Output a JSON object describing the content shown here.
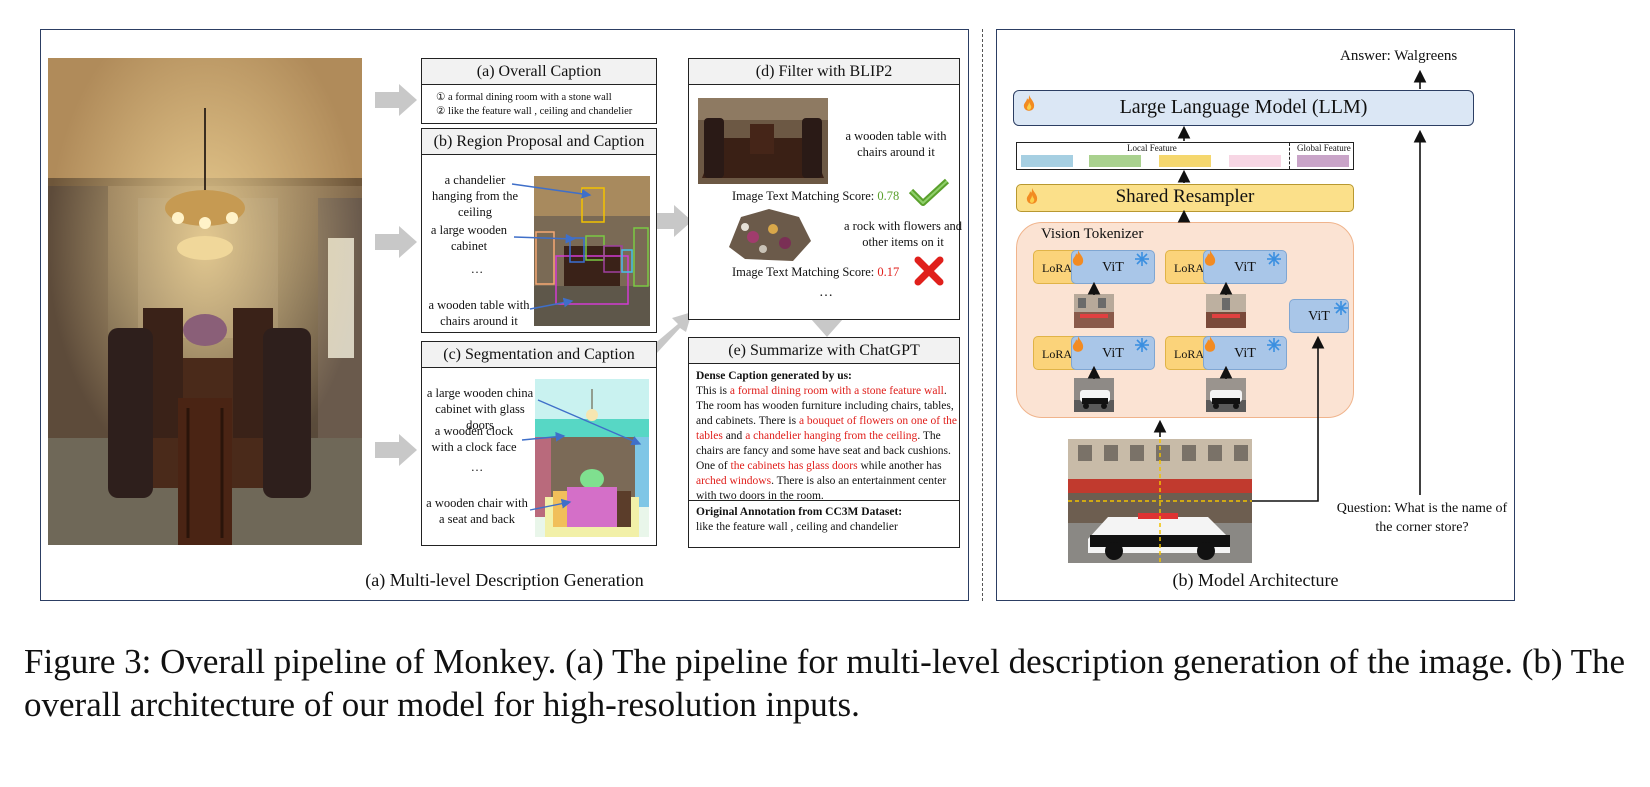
{
  "left_panel": {
    "title": "(a) Multi-level Description Generation",
    "overall": {
      "title": "(a) Overall Caption",
      "line1": "① a formal dining room with a stone wall",
      "line2": "② like the feature wall , ceiling and chandelier"
    },
    "region": {
      "title": "(b) Region Proposal and Caption",
      "captions": [
        "a chandelier hanging from the ceiling",
        "a large wooden cabinet",
        "…",
        "a wooden table with chairs around it"
      ]
    },
    "segmentation": {
      "title": "(c) Segmentation and Caption",
      "captions": [
        "a large wooden china cabinet with glass doors",
        "a wooden clock with a clock face",
        "…",
        "a wooden chair with a seat and back"
      ]
    },
    "filter": {
      "title": "(d) Filter with BLIP2",
      "item1_caption": "a wooden table with chairs around it",
      "item1_score_label": "Image Text Matching Score:",
      "item1_score": "0.78",
      "item2_caption": "a rock with flowers and other items on it",
      "item2_score_label": "Image Text Matching Score:",
      "item2_score": "0.17",
      "ellipsis": "…"
    },
    "summarize": {
      "title": "(e) Summarize with ChatGPT",
      "dense_heading": "Dense Caption generated by us:",
      "segments": [
        {
          "text": "This is ",
          "hl": false
        },
        {
          "text": "a formal dining room with a stone feature wall",
          "hl": true
        },
        {
          "text": ". The room has wooden furniture including chairs, tables, and cabinets. There is ",
          "hl": false
        },
        {
          "text": "a bouquet of flowers on one of the tables",
          "hl": true
        },
        {
          "text": " and ",
          "hl": false
        },
        {
          "text": "a chandelier hanging from the ceiling",
          "hl": true
        },
        {
          "text": ". The chairs are fancy and some have seat and back cushions. One of ",
          "hl": false
        },
        {
          "text": "the cabinets has glass doors",
          "hl": true
        },
        {
          "text": " while another has ",
          "hl": false
        },
        {
          "text": "arched windows",
          "hl": true
        },
        {
          "text": ". There is also an entertainment center with two doors in the room.",
          "hl": false
        }
      ],
      "original_heading": "Original Annotation from CC3M Dataset:",
      "original_text": "like the feature wall , ceiling and chandelier"
    }
  },
  "right_panel": {
    "title": "(b) Model Architecture",
    "answer": "Answer:  Walgreens",
    "llm": "Large Language Model (LLM)",
    "local_feature": "Local Feature",
    "global_feature": "Global Feature",
    "resampler": "Shared Resampler",
    "tokenizer": "Vision Tokenizer",
    "lora": "LoRA",
    "vit": "ViT",
    "question": "Question: What is the name of the corner store?"
  },
  "figure_caption": "Figure 3: Overall pipeline of Monkey. (a) The pipeline for multi-level description generation of the image. (b) The overall architecture of our model for high-resolution inputs.",
  "colors": {
    "panel_border": "#2c3e63",
    "highlight_red": "#e0201c",
    "score_green": "#5aa02c",
    "llm_fill": "#dbe7f5",
    "resampler_fill": "#fbe08a",
    "tokenizer_fill": "#fbe3d3",
    "feature_colors": [
      "#a6cfe2",
      "#a9d18e",
      "#f5d76e",
      "#f7d6e4",
      "#c9a4c8"
    ]
  },
  "icons": [
    "fire-icon",
    "snowflake-icon",
    "check-icon",
    "cross-icon"
  ]
}
